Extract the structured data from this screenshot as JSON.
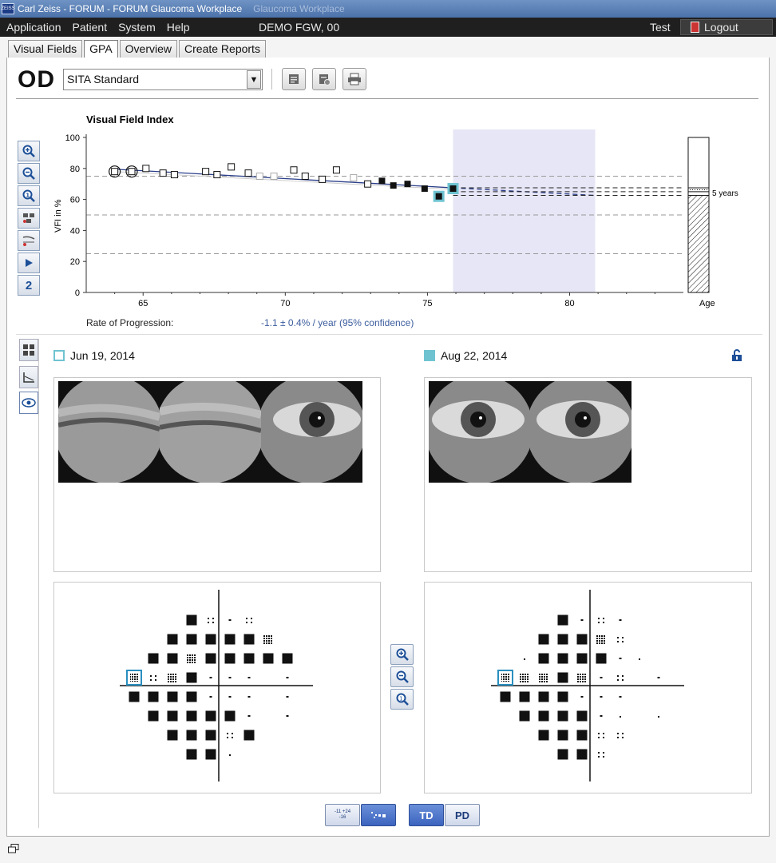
{
  "window": {
    "title": "Carl Zeiss - FORUM - FORUM Glaucoma Workplace",
    "logo_text": "ZEISS",
    "faded_title": "Glaucoma Workplace"
  },
  "menu": {
    "items": [
      "Application",
      "Patient",
      "System",
      "Help"
    ],
    "patient_label": "DEMO FGW, 00",
    "user": "Test",
    "logout": "Logout"
  },
  "tabs": [
    {
      "label": "Visual Fields",
      "active": false
    },
    {
      "label": "GPA",
      "active": true
    },
    {
      "label": "Overview",
      "active": false
    },
    {
      "label": "Create Reports",
      "active": false
    }
  ],
  "toolbar": {
    "eye": "OD",
    "strategy": "SITA Standard"
  },
  "left_tools": {
    "icons": [
      "zoom-in-icon",
      "zoom-out-icon",
      "zoom-reset-icon",
      "series-settings-icon",
      "trend-settings-icon",
      "play-icon"
    ],
    "count_label": "2"
  },
  "chart_data": {
    "type": "scatter",
    "title": "Visual Field Index",
    "xlabel": "",
    "ylabel": "VFI in %",
    "xlim": [
      63,
      84
    ],
    "ylim": [
      0,
      100
    ],
    "x_ticks": [
      65,
      70,
      75,
      80
    ],
    "y_ticks": [
      0,
      20,
      40,
      60,
      80,
      100
    ],
    "grid": false,
    "reference_lines_y": [
      75,
      50,
      25
    ],
    "projection_region_x": [
      75.9,
      80.9
    ],
    "series": [
      {
        "type": "baseline",
        "points": [
          [
            64.0,
            78
          ],
          [
            64.6,
            78
          ]
        ]
      },
      {
        "type": "open",
        "points": [
          [
            65.1,
            80
          ],
          [
            65.7,
            77
          ],
          [
            66.1,
            76
          ],
          [
            67.2,
            78
          ],
          [
            67.6,
            76
          ],
          [
            68.1,
            81
          ],
          [
            68.7,
            77
          ],
          [
            70.3,
            79
          ],
          [
            70.7,
            75
          ],
          [
            71.3,
            73
          ],
          [
            71.8,
            79
          ],
          [
            72.9,
            70
          ]
        ]
      },
      {
        "type": "faded",
        "points": [
          [
            69.1,
            75
          ],
          [
            69.6,
            75
          ],
          [
            72.4,
            74
          ]
        ]
      },
      {
        "type": "filled",
        "points": [
          [
            73.4,
            72
          ],
          [
            73.8,
            69
          ],
          [
            74.3,
            70
          ],
          [
            74.9,
            67
          ]
        ]
      },
      {
        "type": "selected",
        "points": [
          [
            75.4,
            62
          ],
          [
            75.9,
            67
          ]
        ]
      }
    ],
    "trend": {
      "x0": 64.0,
      "y0": 79.5,
      "x1": 75.9,
      "y1": 67.5,
      "proj_x1": 80.9,
      "proj_y1": 62.6
    },
    "projection_levels": [
      67.5,
      65.0,
      62.6
    ],
    "age_bar": {
      "label": "Age",
      "projection_label": "5 years"
    }
  },
  "rate": {
    "label": "Rate of Progression:",
    "value": "-1.1 ± 0.4% / year (95% confidence)"
  },
  "lower_tools": [
    "gpa-layout-icon",
    "trend-chart-icon",
    "eye-view-icon"
  ],
  "exams": [
    {
      "date": "Jun 19, 2014"
    },
    {
      "date": "Aug 22, 2014"
    }
  ],
  "bottom_buttons": {
    "values": "-11 +24 -16",
    "symbols": "symbols",
    "td": "TD",
    "pd": "PD"
  }
}
